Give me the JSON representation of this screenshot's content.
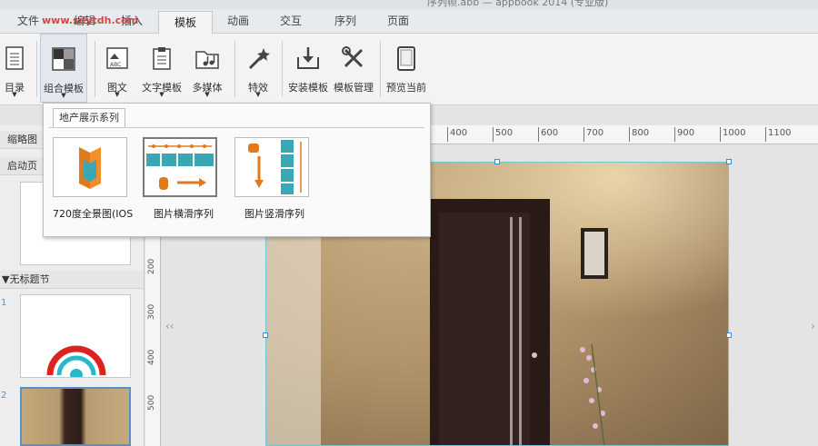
{
  "titlebar": {
    "title": "序列帧.abb — appbook 2014 (专业版)"
  },
  "watermark": {
    "text": "www.sdytdh.com"
  },
  "tabs": [
    "文件",
    "编辑",
    "插入",
    "模板",
    "动画",
    "交互",
    "序列",
    "页面"
  ],
  "active_tab": "模板",
  "ribbon": {
    "buttons": [
      {
        "label": "目录",
        "icon": "document-icon"
      },
      {
        "label": "组合模板",
        "icon": "layout-grid-icon"
      },
      {
        "label": "图文",
        "icon": "image-text-icon"
      },
      {
        "label": "文字模板",
        "icon": "clipboard-icon"
      },
      {
        "label": "多媒体",
        "icon": "music-folder-icon"
      },
      {
        "label": "特效",
        "icon": "magic-wand-icon"
      },
      {
        "label": "安装模板",
        "icon": "install-icon"
      },
      {
        "label": "模板管理",
        "icon": "tools-icon"
      },
      {
        "label": "预览当前",
        "icon": "tablet-icon"
      }
    ]
  },
  "left_panel": {
    "tab_label": "缩略图",
    "start_page_label": "启动页",
    "section_label": "▼无标题节",
    "page_numbers": [
      "1",
      "2"
    ]
  },
  "ruler": {
    "h_ticks": [
      "400",
      "500",
      "600",
      "700",
      "800",
      "900",
      "1000",
      "1100"
    ],
    "v_ticks": [
      "200",
      "300",
      "400",
      "500"
    ]
  },
  "popup": {
    "category_tab": "地产展示系列",
    "items": [
      {
        "label": "720度全景图(IOS",
        "icon": "panorama-icon"
      },
      {
        "label": "图片横滑序列",
        "icon": "horizontal-slide-icon"
      },
      {
        "label": "图片竖滑序列",
        "icon": "vertical-slide-icon"
      }
    ]
  },
  "colors": {
    "accent": "#e07a1c",
    "teal": "#3aa7b4",
    "selection": "#74c7cf"
  }
}
